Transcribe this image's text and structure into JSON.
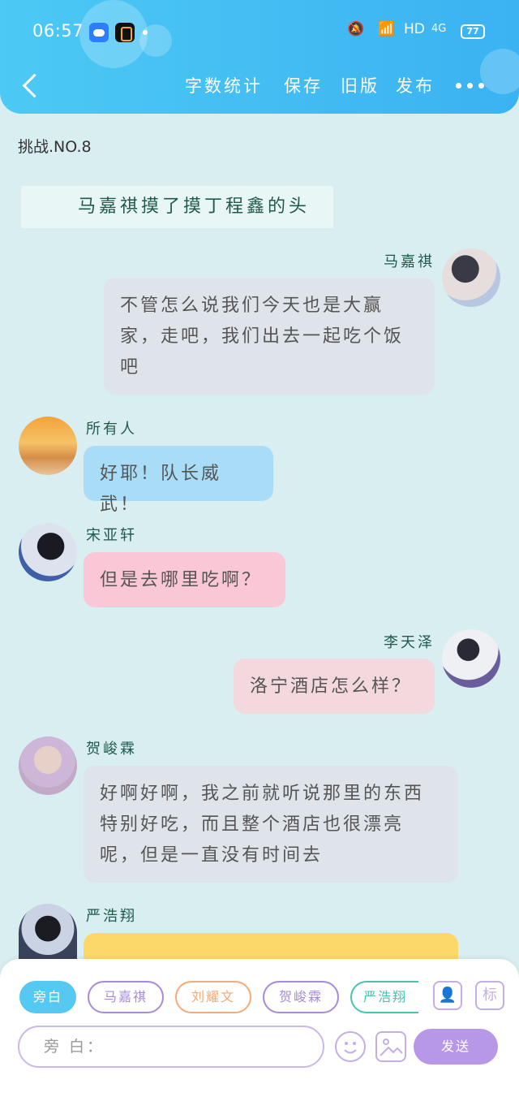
{
  "status_bar": {
    "time": "06:57",
    "network": "HD",
    "signal": "4G",
    "battery": "77"
  },
  "toolbar": {
    "word_count": "字数统计",
    "save": "保存",
    "old_version": "旧版",
    "publish": "发布"
  },
  "content": {
    "challenge_title": "挑战.NO.8",
    "narration": "马嘉祺摸了摸丁程鑫的头"
  },
  "messages": [
    {
      "sender": "马嘉祺",
      "text": "不管怎么说我们今天也是大赢家，走吧，我们出去一起吃个饭吧"
    },
    {
      "sender": "所有人",
      "text": "好耶！队长威武！"
    },
    {
      "sender": "宋亚轩",
      "text": "但是去哪里吃啊？"
    },
    {
      "sender": "李天泽",
      "text": "洛宁酒店怎么样？"
    },
    {
      "sender": "贺峻霖",
      "text": "好啊好啊，我之前就听说那里的东西特别好吃，而且整个酒店也很漂亮呢，但是一直没有时间去"
    },
    {
      "sender": "严浩翔",
      "text": ""
    }
  ],
  "composer": {
    "roles": [
      "旁白",
      "马嘉祺",
      "刘耀文",
      "贺峻霖",
      "严浩翔"
    ],
    "mark_label": "标",
    "input_value": "旁 白：",
    "send_label": "发送"
  },
  "colors": {
    "header_gradient_start": "#4cc9f4",
    "header_gradient_end": "#3bb2f2",
    "background": "#d9eef0",
    "send_button": "#b797e8",
    "active_role": "#56c9f2"
  }
}
